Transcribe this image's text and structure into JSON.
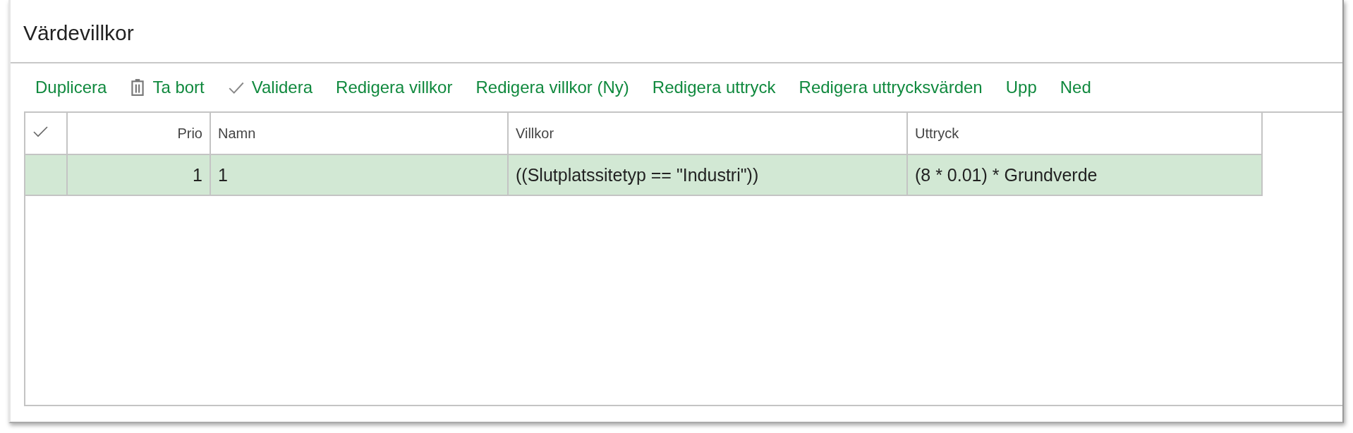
{
  "title": "Värdevillkor",
  "toolbar": [
    {
      "label": "Duplicera",
      "kind": "plain"
    },
    {
      "label": "Ta bort",
      "kind": "trash"
    },
    {
      "label": "Validera",
      "kind": "check"
    },
    {
      "label": "Redigera villkor",
      "kind": "plain"
    },
    {
      "label": "Redigera villkor (Ny)",
      "kind": "plain"
    },
    {
      "label": "Redigera uttryck",
      "kind": "plain"
    },
    {
      "label": "Redigera uttrycksvärden",
      "kind": "plain"
    },
    {
      "label": "Upp",
      "kind": "plain"
    },
    {
      "label": "Ned",
      "kind": "plain"
    }
  ],
  "table": {
    "columns": [
      "Prio",
      "Namn",
      "Villkor",
      "Uttryck"
    ],
    "rows": [
      {
        "selected": true,
        "cells": [
          "1",
          "1",
          "((Slutplatssitetyp == \"Industri\"))",
          "(8 * 0.01) * Grundverde"
        ]
      }
    ]
  }
}
